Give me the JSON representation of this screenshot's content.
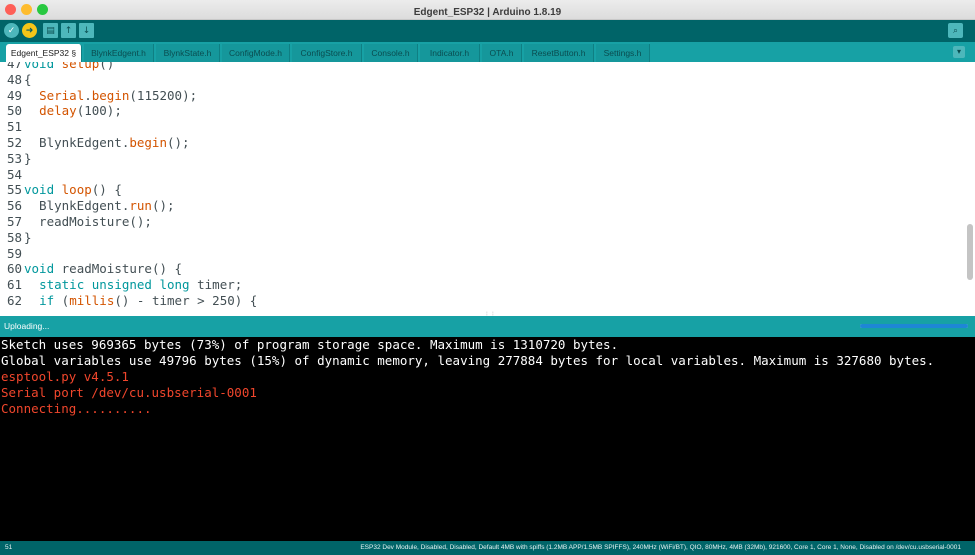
{
  "window": {
    "title": "Edgent_ESP32 | Arduino 1.8.19"
  },
  "toolbar": {
    "verify_icon": "checkmark-icon",
    "upload_icon": "arrow-right-icon",
    "new_icon": "new-file-icon",
    "open_icon": "arrow-up-icon",
    "save_icon": "arrow-down-icon",
    "serial_icon": "magnifier-icon"
  },
  "tabs": [
    {
      "label": "Edgent_ESP32 §",
      "active": true
    },
    {
      "label": "BlynkEdgent.h"
    },
    {
      "label": "BlynkState.h"
    },
    {
      "label": "ConfigMode.h"
    },
    {
      "label": "ConfigStore.h"
    },
    {
      "label": "Console.h"
    },
    {
      "label": "Indicator.h"
    },
    {
      "label": "OTA.h"
    },
    {
      "label": "ResetButton.h"
    },
    {
      "label": "Settings.h"
    }
  ],
  "editor": {
    "lines": [
      {
        "n": "47",
        "tokens": [
          {
            "t": "void ",
            "c": "kw"
          },
          {
            "t": "setup",
            "c": "fn"
          },
          {
            "t": "()"
          }
        ]
      },
      {
        "n": "48",
        "tokens": [
          {
            "t": "{"
          }
        ]
      },
      {
        "n": "49",
        "tokens": [
          {
            "t": "  "
          },
          {
            "t": "Serial",
            "c": "fn"
          },
          {
            "t": "."
          },
          {
            "t": "begin",
            "c": "fn"
          },
          {
            "t": "(115200);"
          }
        ]
      },
      {
        "n": "50",
        "tokens": [
          {
            "t": "  "
          },
          {
            "t": "delay",
            "c": "fn"
          },
          {
            "t": "(100);"
          }
        ]
      },
      {
        "n": "51",
        "tokens": []
      },
      {
        "n": "52",
        "tokens": [
          {
            "t": "  BlynkEdgent."
          },
          {
            "t": "begin",
            "c": "fn"
          },
          {
            "t": "();"
          }
        ]
      },
      {
        "n": "53",
        "tokens": [
          {
            "t": "}"
          }
        ]
      },
      {
        "n": "54",
        "tokens": []
      },
      {
        "n": "55",
        "tokens": [
          {
            "t": "void ",
            "c": "kw"
          },
          {
            "t": "loop",
            "c": "fn"
          },
          {
            "t": "() {"
          }
        ]
      },
      {
        "n": "56",
        "tokens": [
          {
            "t": "  BlynkEdgent."
          },
          {
            "t": "run",
            "c": "fn"
          },
          {
            "t": "();"
          }
        ]
      },
      {
        "n": "57",
        "tokens": [
          {
            "t": "  readMoisture();"
          }
        ]
      },
      {
        "n": "58",
        "tokens": [
          {
            "t": "}"
          }
        ]
      },
      {
        "n": "59",
        "tokens": []
      },
      {
        "n": "60",
        "tokens": [
          {
            "t": "void ",
            "c": "kw"
          },
          {
            "t": "readMoisture() {"
          }
        ]
      },
      {
        "n": "61",
        "tokens": [
          {
            "t": "  "
          },
          {
            "t": "static ",
            "c": "kw"
          },
          {
            "t": "unsigned ",
            "c": "kw"
          },
          {
            "t": "long ",
            "c": "kw"
          },
          {
            "t": "timer;"
          }
        ]
      },
      {
        "n": "62",
        "tokens": [
          {
            "t": "  "
          },
          {
            "t": "if",
            "c": "kw"
          },
          {
            "t": " ("
          },
          {
            "t": "millis",
            "c": "fn"
          },
          {
            "t": "() - timer > 250) {"
          }
        ]
      }
    ],
    "scroll_position": 0.72
  },
  "status": {
    "text": "Uploading...",
    "progress": 1.0
  },
  "console": {
    "lines": [
      {
        "text": "Sketch uses 969365 bytes (73%) of program storage space. Maximum is 1310720 bytes.",
        "type": "info"
      },
      {
        "text": "Global variables use 49796 bytes (15%) of dynamic memory, leaving 277884 bytes for local variables. Maximum is 327680 bytes.",
        "type": "info"
      },
      {
        "text": "esptool.py v4.5.1",
        "type": "err"
      },
      {
        "text": "Serial port /dev/cu.usbserial-0001",
        "type": "err"
      },
      {
        "text": "Connecting..........",
        "type": "err"
      }
    ]
  },
  "footer": {
    "line_number": "51",
    "board_info": "ESP32 Dev Module, Disabled, Disabled, Default 4MB with spiffs (1.2MB APP/1.5MB SPIFFS), 240MHz (WiFi/BT), QIO, 80MHz, 4MB (32Mb), 921600, Core 1, Core 1, None, Disabled on /dev/cu.usbserial-0001"
  },
  "colors": {
    "teal_dark": "#006468",
    "teal": "#17a1a5",
    "keyword": "#00979c",
    "function": "#d35400",
    "error": "#f0462c"
  }
}
